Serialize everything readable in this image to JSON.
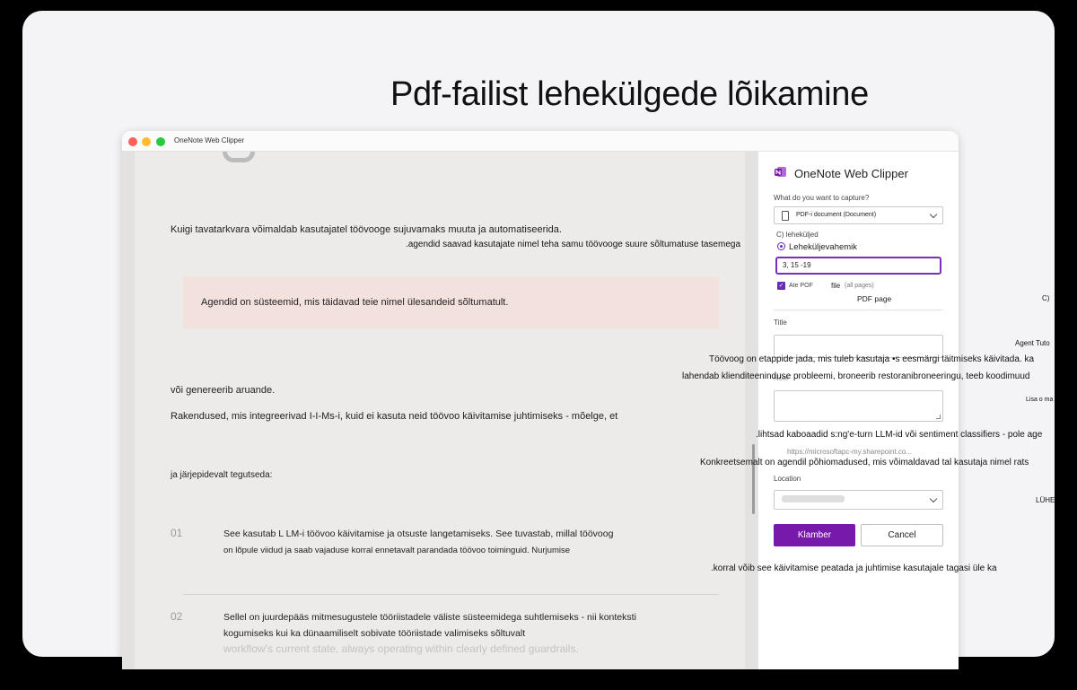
{
  "headline": "Pdf-failist lehekülgede lõikamine",
  "window": {
    "title": "OneNote Web Clipper"
  },
  "document": {
    "line1": "Kuigi tavatarkvara võimaldab kasutajatel töövooge sujuvamaks muuta ja automatiseerida.",
    "line2": ".agendid saavad kasutajate nimel teha samu töövooge suure sõltumatuse tasemega",
    "callout": "Agendid on süsteemid, mis täidavad teie nimel ülesandeid sõltumatult.",
    "line3": "või genereerib aruande.",
    "line4": "Rakendused, mis integreerivad I-I-Ms-i, kuid ei kasuta neid töövoo käivitamise juhtimiseks - mõelge, et",
    "line5": "ja järjepidevalt tegutseda:",
    "item1_num": "01",
    "item1_line1": "See kasutab L LM-i töövoo käivitamise ja otsuste langetamiseks. See tuvastab, millal töövoog",
    "item1_line2": "on lõpule viidud ja saab vajaduse korral ennetavalt parandada töövoo toiminguid. Nurjumise",
    "item2_num": "02",
    "item2_line1": "Sellel on juurdepääs mitmesugustele tööriistadele väliste süsteemidega suhtlemiseks - nii konteksti",
    "item2_line2": "kogumiseks kui ka dünaamiliselt sobivate tööriistade valimiseks sõltuvalt",
    "item2_line3": "workflow's current state, always operating within clearly defined guardrails."
  },
  "panel": {
    "title": "OneNote Web Clipper",
    "capture_label": "What do you want to capture?",
    "capture_value": "PDF-i document (Document)",
    "pages_label": "C) leheküljed",
    "range_label": "Leheküljevahemik",
    "range_value": "3, 15 -19",
    "attach_label": "Ate POF",
    "file_label": "file",
    "all_pages": "(all pages)",
    "pdf_page": "PDF page",
    "title_label": "Title",
    "note_label": "Note",
    "url": "https://microsoftapc-my.sharepoint.co...",
    "location_label": "Location",
    "clip_button": "Klamber",
    "cancel_button": "Cancel"
  },
  "overlays": {
    "c_right": "C)",
    "agent_tuto": "Agent Tuto",
    "workflow_def": "Töövoog on etappide jada, mis tuleb kasutaja •s eesmärgi täitmiseks käivitada. ka",
    "resolves": "lahendab klienditeeninduse probleemi, broneerib restoranibroneeringu, teeb koodimuud",
    "lisa": "Lisa o ma",
    "simple_chatbots": ".lihtsad kaboaadid s:ng'e-turn LLM-id või sentiment classifiers - pole age",
    "specifically": "Konkreetsemalt on agendil põhiomadused, mis võimaldavad tal kasutaja nimel rats",
    "luhe": "LÜHE",
    "stop": ".korral võib see käivitamise peatada ja juhtimise kasutajale tagasi üle ka"
  },
  "colors": {
    "accent": "#7719aa",
    "callout_bg": "#f2e1dc"
  }
}
